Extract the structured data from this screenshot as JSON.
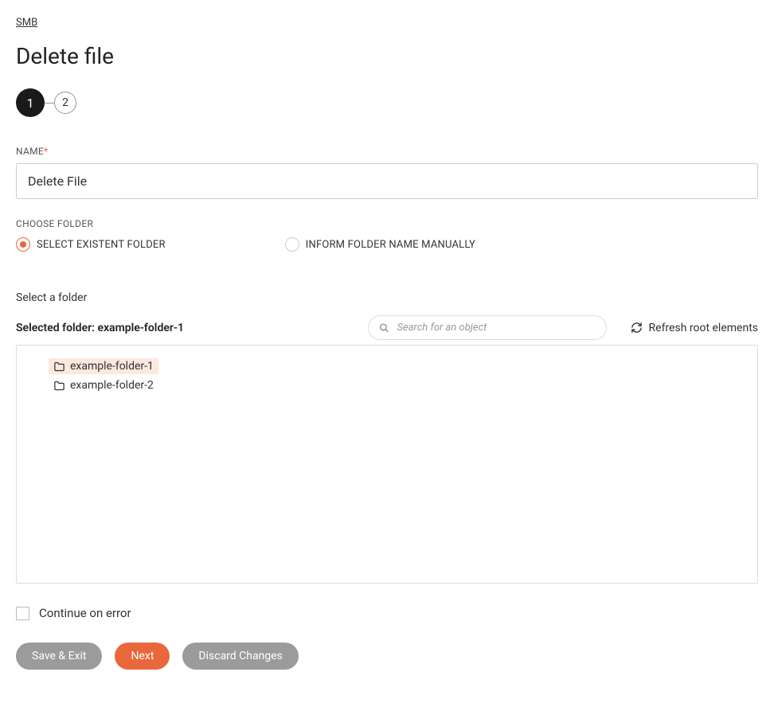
{
  "breadcrumb": "SMB",
  "page_title": "Delete file",
  "stepper": {
    "step1": "1",
    "step2": "2"
  },
  "form": {
    "name_label": "NAME",
    "name_value": "Delete File",
    "choose_folder_label": "CHOOSE FOLDER",
    "radio_select_existent": "SELECT EXISTENT FOLDER",
    "radio_inform_manually": "INFORM FOLDER NAME MANUALLY"
  },
  "folder_selector": {
    "heading": "Select a folder",
    "selected_label": "Selected folder: ",
    "selected_value": "example-folder-1",
    "search_placeholder": "Search for an object",
    "refresh_label": "Refresh root elements",
    "items": [
      {
        "name": "example-folder-1",
        "selected": true
      },
      {
        "name": "example-folder-2",
        "selected": false
      }
    ]
  },
  "continue_on_error_label": "Continue on error",
  "buttons": {
    "save_exit": "Save & Exit",
    "next": "Next",
    "discard": "Discard Changes"
  }
}
